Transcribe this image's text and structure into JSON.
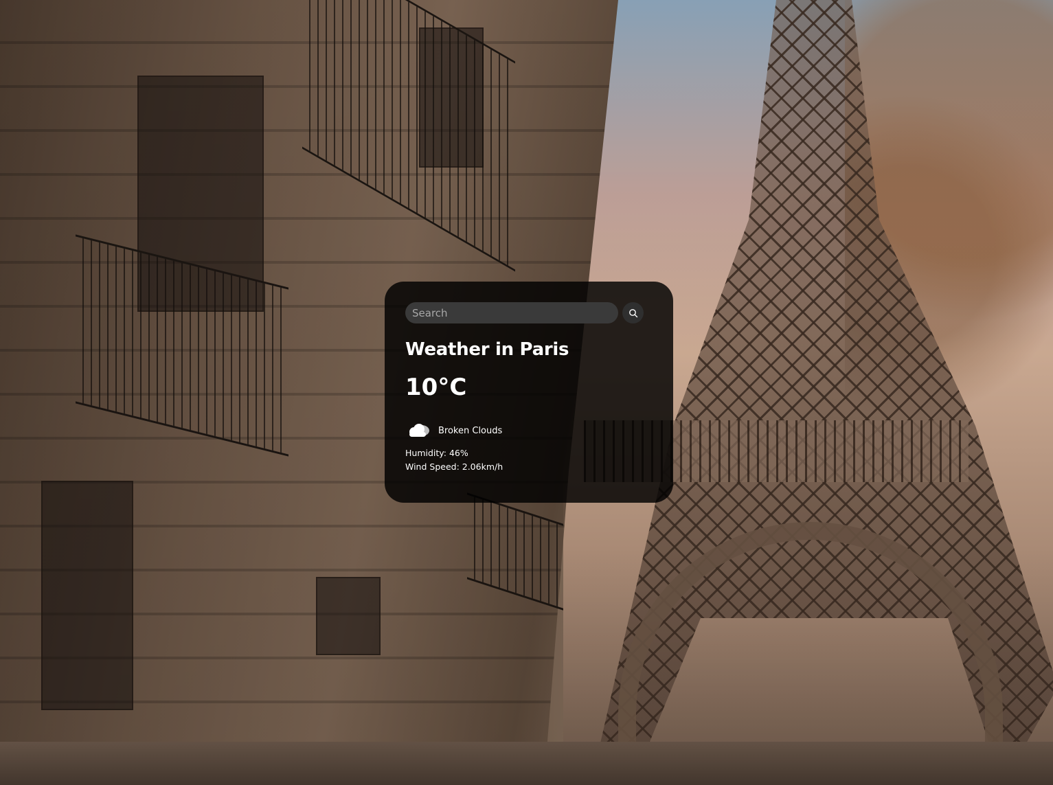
{
  "search": {
    "placeholder": "Search",
    "value": ""
  },
  "weather": {
    "title": "Weather in Paris",
    "temperature": "10°C",
    "condition": "Broken Clouds",
    "condition_icon": "cloud-icon",
    "humidity": "Humidity: 46%",
    "wind": "Wind Speed: 2.06km/h"
  },
  "colors": {
    "card_background": "#000000",
    "input_background": "#3a3a3a",
    "text": "#ffffff"
  }
}
